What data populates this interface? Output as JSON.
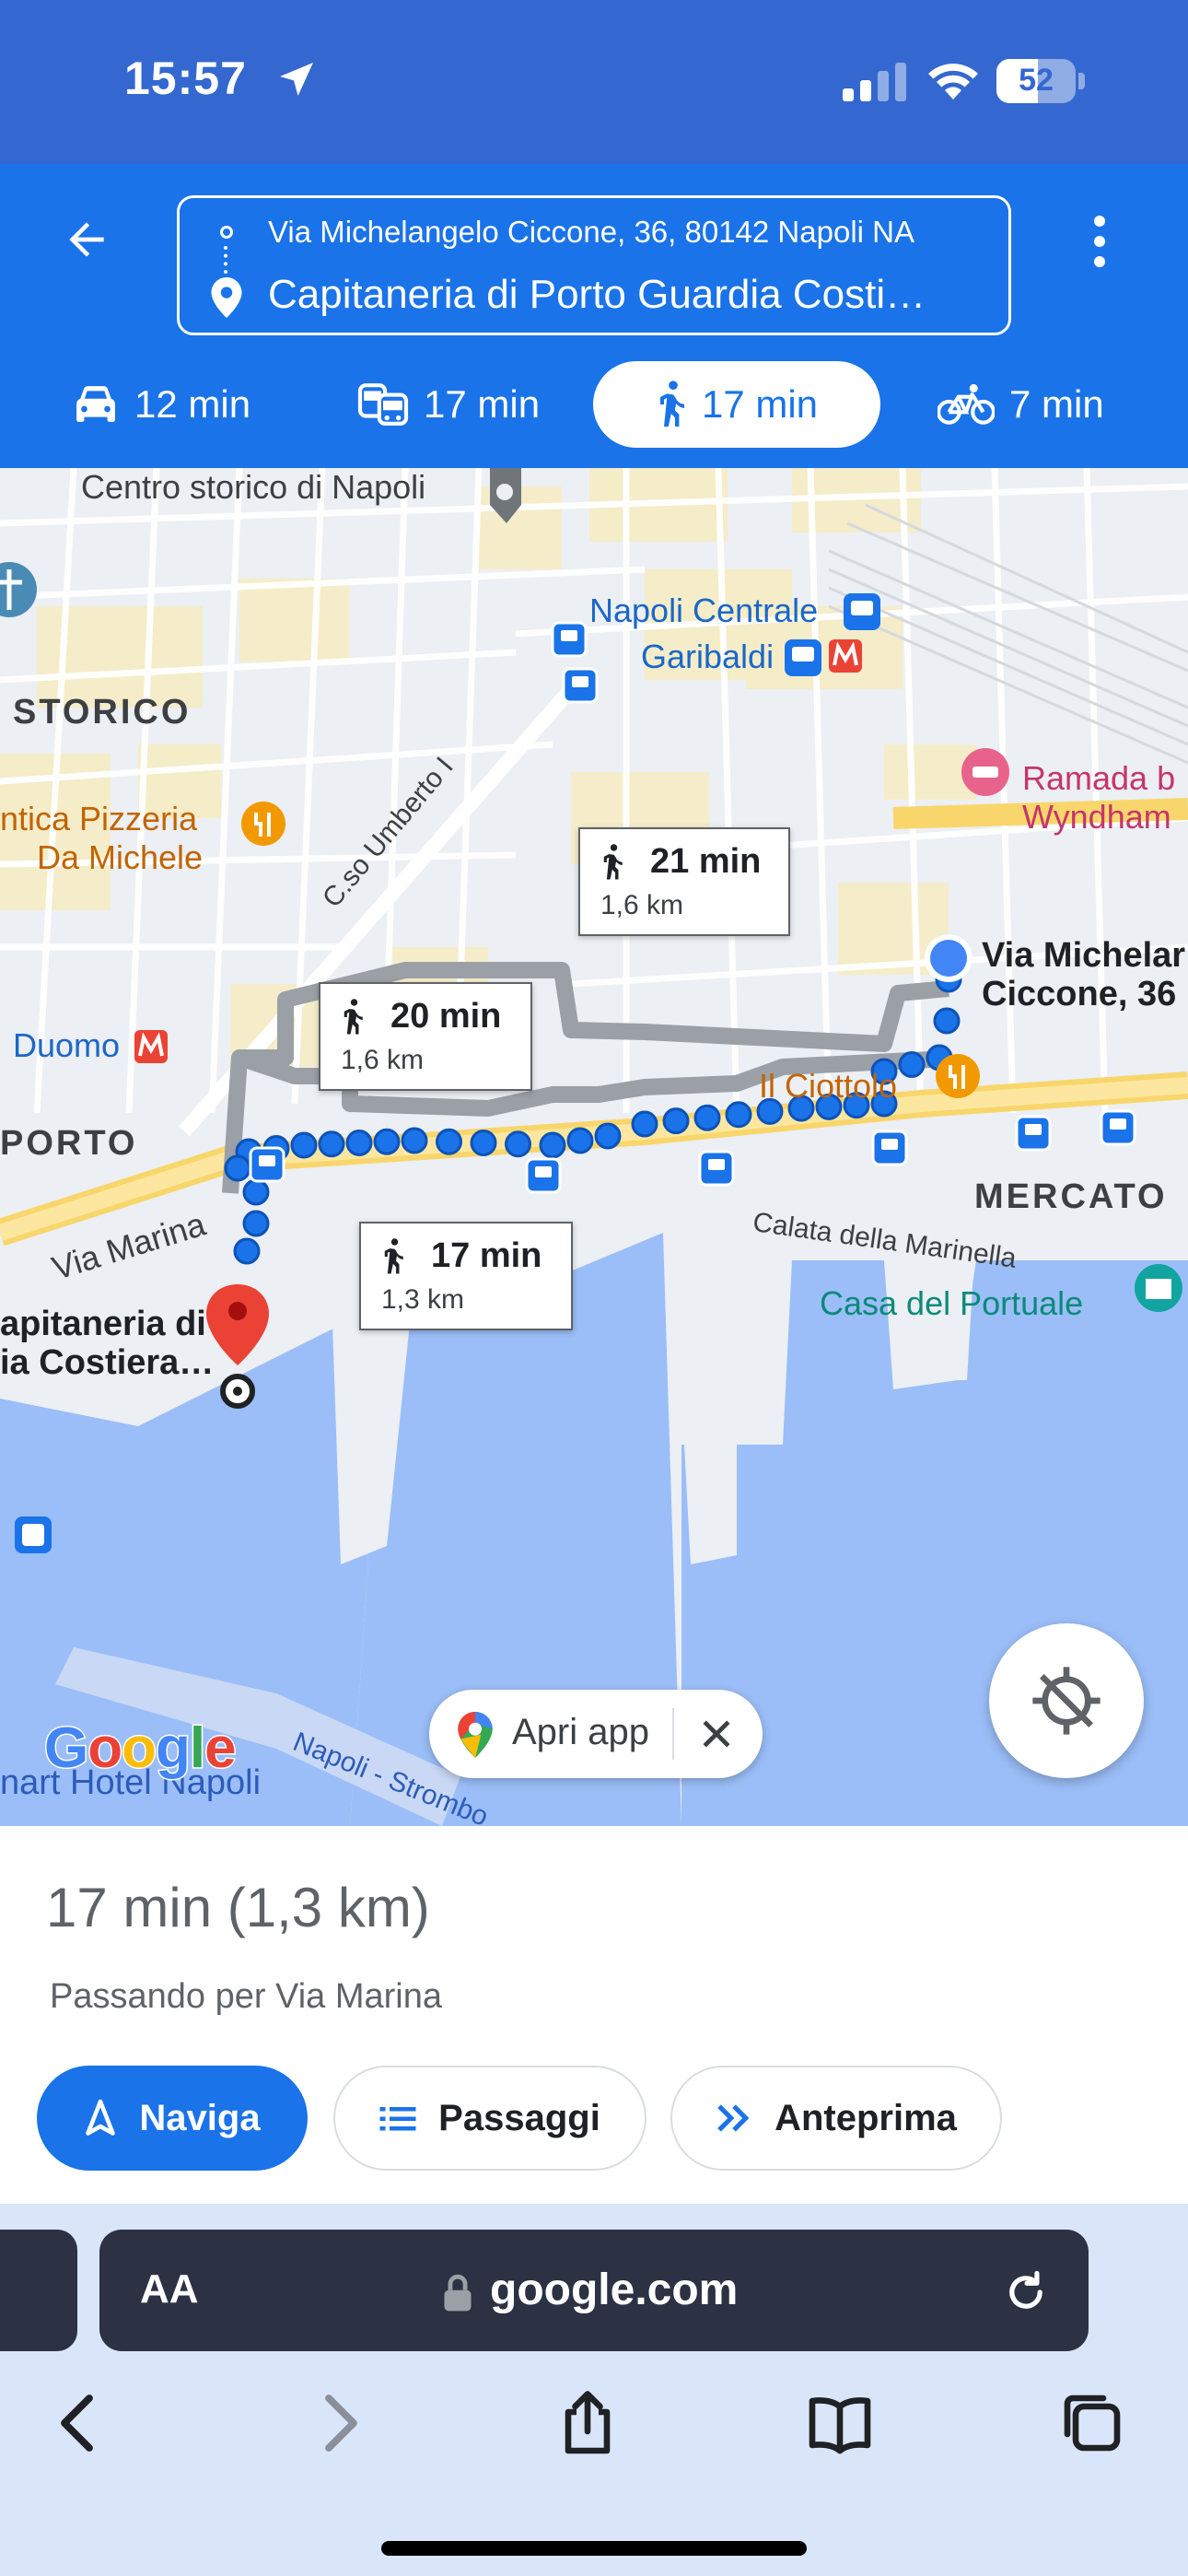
{
  "status_bar": {
    "time": "15:57",
    "battery": "52",
    "battery_level": 0.52,
    "icons": [
      "location-arrow-icon",
      "cellular-signal-icon",
      "wifi-icon",
      "battery-icon"
    ]
  },
  "directions": {
    "origin": "Via Michelangelo Ciccone, 36, 80142 Napoli NA",
    "destination": "Capitaneria di Porto Guardia Costi…",
    "modes": [
      {
        "mode": "drive",
        "label": "12 min",
        "icon": "car-icon",
        "selected": false
      },
      {
        "mode": "transit",
        "label": "17 min",
        "icon": "bus-train-icon",
        "selected": false
      },
      {
        "mode": "walk",
        "label": "17 min",
        "icon": "walking-icon",
        "selected": true
      },
      {
        "mode": "bike",
        "label": "7 min",
        "icon": "bicycle-icon",
        "selected": false
      }
    ]
  },
  "map": {
    "labels": {
      "centro": "Centro storico di Napoli",
      "napoli_centrale": "Napoli Centrale",
      "garibaldi": "Garibaldi",
      "storico": "STORICO",
      "pizzeria_1": "ntica Pizzeria",
      "pizzeria_2": "Da Michele",
      "umberto": "C.so Umberto I",
      "ramada_1": "Ramada b",
      "ramada_2": "Wyndham",
      "origin_1": "Via Michelar",
      "origin_2": "Ciccone, 36",
      "duomo": "Duomo",
      "porto": "PORTO",
      "ciottolo": "Il Ciottolo",
      "mercato": "MERCATO",
      "via_marina": "Via Marina",
      "calata": "Calata della Marinella",
      "casa_portuale": "Casa del Portuale",
      "dest_1": "apitaneria di",
      "dest_2": "ia Costiera…",
      "strombo": "Napoli - Strombo",
      "hotel": "nart Hotel Napoli"
    },
    "routes": [
      {
        "time": "21 min",
        "distance": "1,6 km",
        "primary": false
      },
      {
        "time": "20 min",
        "distance": "1,6 km",
        "primary": false
      },
      {
        "time": "17 min",
        "distance": "1,3 km",
        "primary": true
      }
    ],
    "open_app_label": "Apri app",
    "logo": "Google",
    "colors": {
      "route": "#1a73e8",
      "alt_route": "#9aa0a6",
      "water": "#9bbef8",
      "destination_pin": "#ea4335"
    }
  },
  "summary": {
    "title": "17 min (1,3 km)",
    "via": "Passando per Via Marina"
  },
  "actions": {
    "navigate": "Naviga",
    "steps": "Passaggi",
    "preview": "Anteprima"
  },
  "browser": {
    "text_size": "AA",
    "url": "google.com"
  }
}
